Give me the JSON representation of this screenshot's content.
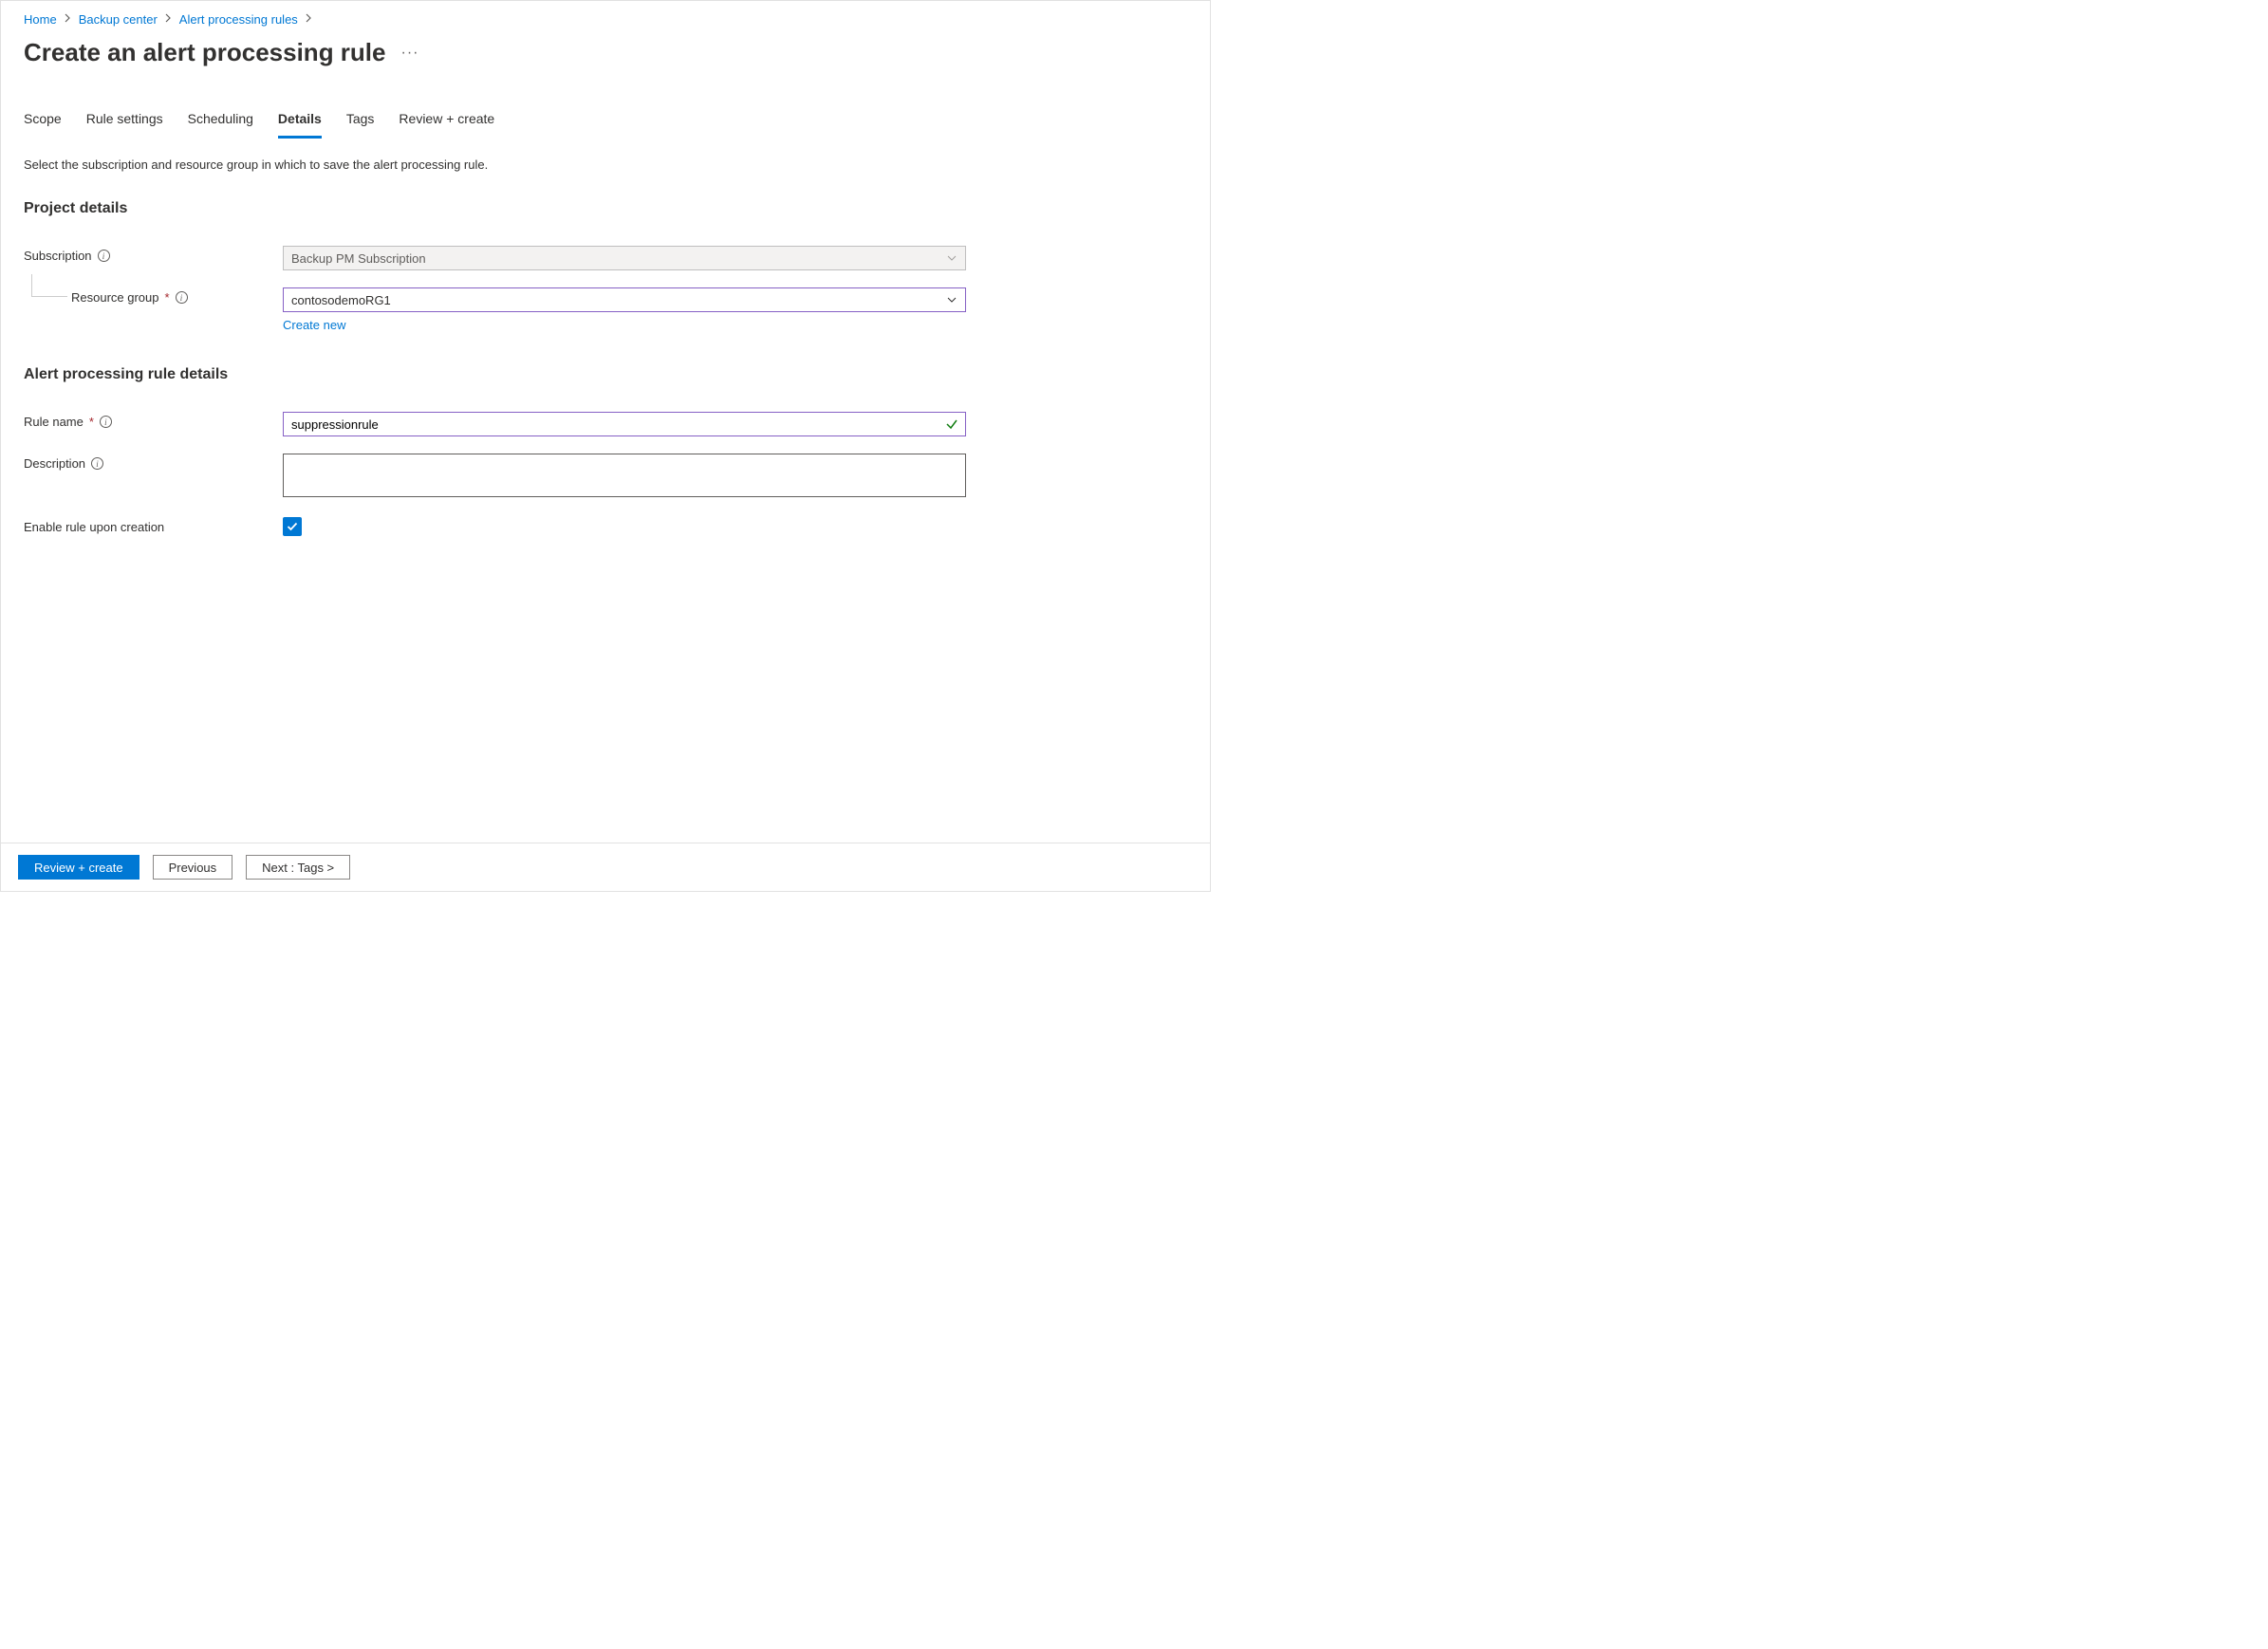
{
  "breadcrumb": {
    "items": [
      "Home",
      "Backup center",
      "Alert processing rules"
    ]
  },
  "page": {
    "title": "Create an alert processing rule"
  },
  "tabs": {
    "items": [
      "Scope",
      "Rule settings",
      "Scheduling",
      "Details",
      "Tags",
      "Review + create"
    ],
    "active": "Details"
  },
  "description": "Select the subscription and resource group in which to save the alert processing rule.",
  "project_details": {
    "heading": "Project details",
    "subscription_label": "Subscription",
    "subscription_value": "Backup PM Subscription",
    "resource_group_label": "Resource group",
    "resource_group_value": "contosodemoRG1",
    "create_new_label": "Create new"
  },
  "rule_details": {
    "heading": "Alert processing rule details",
    "rule_name_label": "Rule name",
    "rule_name_value": "suppressionrule",
    "description_label": "Description",
    "description_value": "",
    "enable_label": "Enable rule upon creation",
    "enable_checked": true
  },
  "footer": {
    "review_create": "Review + create",
    "previous": "Previous",
    "next": "Next : Tags >"
  }
}
